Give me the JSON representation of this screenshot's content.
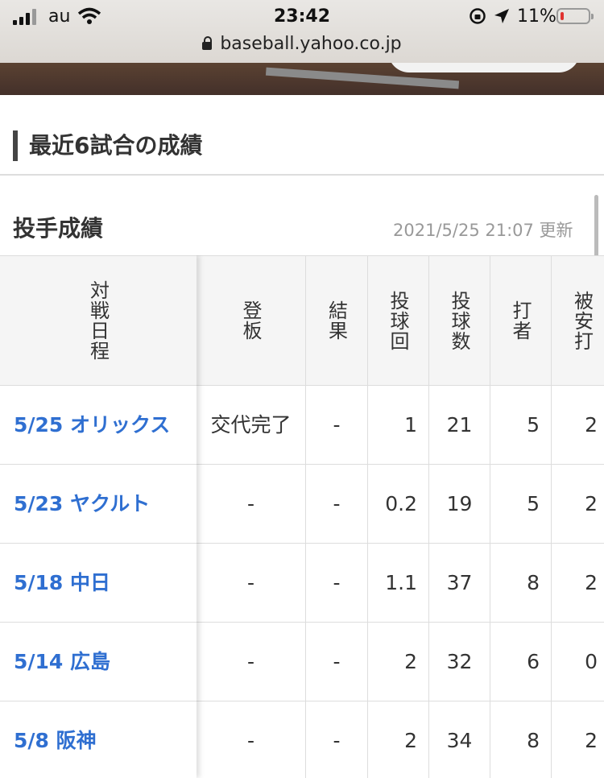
{
  "status_bar": {
    "carrier": "au",
    "time": "23:42",
    "battery": "11%"
  },
  "browser": {
    "url": "baseball.yahoo.co.jp"
  },
  "section": {
    "title": "最近6試合の成績"
  },
  "pitching": {
    "title": "投手成績",
    "updated": "2021/5/25 21:07 更新"
  },
  "table": {
    "headers": [
      "対戦日程",
      "登板",
      "結果",
      "投球回",
      "投球数",
      "打者",
      "被安打"
    ],
    "rows": [
      {
        "date": "5/25 オリックス",
        "appearance": "交代完了",
        "result": "-",
        "innings": "1",
        "pitches": "21",
        "batters": "5",
        "hits": "2"
      },
      {
        "date": "5/23 ヤクルト",
        "appearance": "-",
        "result": "-",
        "innings": "0.2",
        "pitches": "19",
        "batters": "5",
        "hits": "2"
      },
      {
        "date": "5/18 中日",
        "appearance": "-",
        "result": "-",
        "innings": "1.1",
        "pitches": "37",
        "batters": "8",
        "hits": "2"
      },
      {
        "date": "5/14 広島",
        "appearance": "-",
        "result": "-",
        "innings": "2",
        "pitches": "32",
        "batters": "6",
        "hits": "0"
      },
      {
        "date": "5/8 阪神",
        "appearance": "-",
        "result": "-",
        "innings": "2",
        "pitches": "34",
        "batters": "8",
        "hits": "2"
      }
    ]
  },
  "colors": {
    "link": "#2f6fd1",
    "header_bg": "#f5f5f5",
    "accent_bar": "#444444"
  },
  "icons": [
    "signal-icon",
    "wifi-icon",
    "rotation-lock-icon",
    "location-arrow-icon",
    "battery-icon",
    "lock-icon"
  ]
}
